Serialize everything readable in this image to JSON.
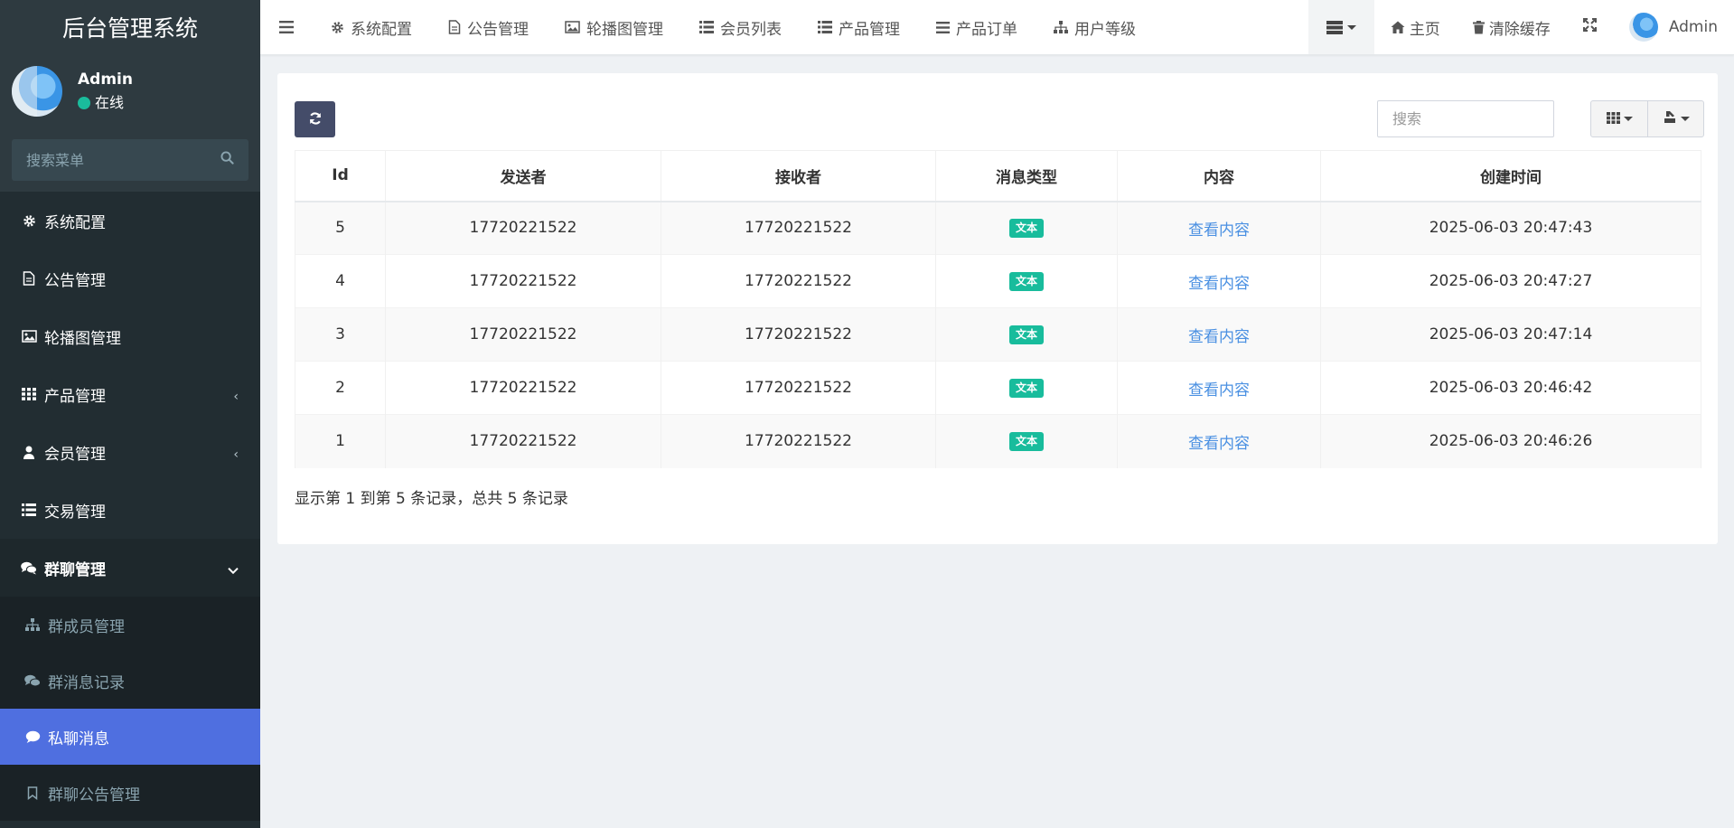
{
  "app": {
    "title": "后台管理系统"
  },
  "user": {
    "name": "Admin",
    "status": "在线"
  },
  "sidebar": {
    "search_placeholder": "搜索菜单",
    "items": [
      {
        "label": "系统配置",
        "icon": "gear-icon"
      },
      {
        "label": "公告管理",
        "icon": "file-icon"
      },
      {
        "label": "轮播图管理",
        "icon": "image-icon"
      },
      {
        "label": "产品管理",
        "icon": "grid-icon",
        "arrow": "‹"
      },
      {
        "label": "会员管理",
        "icon": "user-icon",
        "arrow": "‹"
      },
      {
        "label": "交易管理",
        "icon": "list-icon"
      },
      {
        "label": "群聊管理",
        "icon": "comments-icon",
        "arrow": "⌄"
      }
    ],
    "subitems": [
      {
        "label": "群成员管理",
        "icon": "sitemap-icon"
      },
      {
        "label": "群消息记录",
        "icon": "comments-icon"
      },
      {
        "label": "私聊消息",
        "icon": "comment-icon"
      },
      {
        "label": "群聊公告管理",
        "icon": "bookmark-icon"
      }
    ]
  },
  "topnav": {
    "tabs": [
      {
        "label": "系统配置",
        "icon": "gear-icon"
      },
      {
        "label": "公告管理",
        "icon": "file-icon"
      },
      {
        "label": "轮播图管理",
        "icon": "image-icon"
      },
      {
        "label": "会员列表",
        "icon": "list-icon"
      },
      {
        "label": "产品管理",
        "icon": "list-icon"
      },
      {
        "label": "产品订单",
        "icon": "bars-icon"
      },
      {
        "label": "用户等级",
        "icon": "sitemap-icon"
      }
    ],
    "home_label": "主页",
    "clear_cache_label": "清除缓存",
    "user_name": "Admin"
  },
  "toolbar": {
    "search_placeholder": "搜索"
  },
  "table": {
    "columns": [
      "Id",
      "发送者",
      "接收者",
      "消息类型",
      "内容",
      "创建时间"
    ],
    "rows": [
      {
        "id": "5",
        "sender": "17720221522",
        "receiver": "17720221522",
        "type": "文本",
        "content": "查看内容",
        "created": "2025-06-03 20:47:43"
      },
      {
        "id": "4",
        "sender": "17720221522",
        "receiver": "17720221522",
        "type": "文本",
        "content": "查看内容",
        "created": "2025-06-03 20:47:27"
      },
      {
        "id": "3",
        "sender": "17720221522",
        "receiver": "17720221522",
        "type": "文本",
        "content": "查看内容",
        "created": "2025-06-03 20:47:14"
      },
      {
        "id": "2",
        "sender": "17720221522",
        "receiver": "17720221522",
        "type": "文本",
        "content": "查看内容",
        "created": "2025-06-03 20:46:42"
      },
      {
        "id": "1",
        "sender": "17720221522",
        "receiver": "17720221522",
        "type": "文本",
        "content": "查看内容",
        "created": "2025-06-03 20:46:26"
      }
    ],
    "footer": "显示第 1 到第 5 条记录，总共 5 条记录"
  },
  "colors": {
    "sidebar_bg": "#222d32",
    "active_item": "#4f6fe0",
    "badge": "#18bc9c",
    "link": "#4a90e2",
    "refresh_btn": "#444c69"
  }
}
